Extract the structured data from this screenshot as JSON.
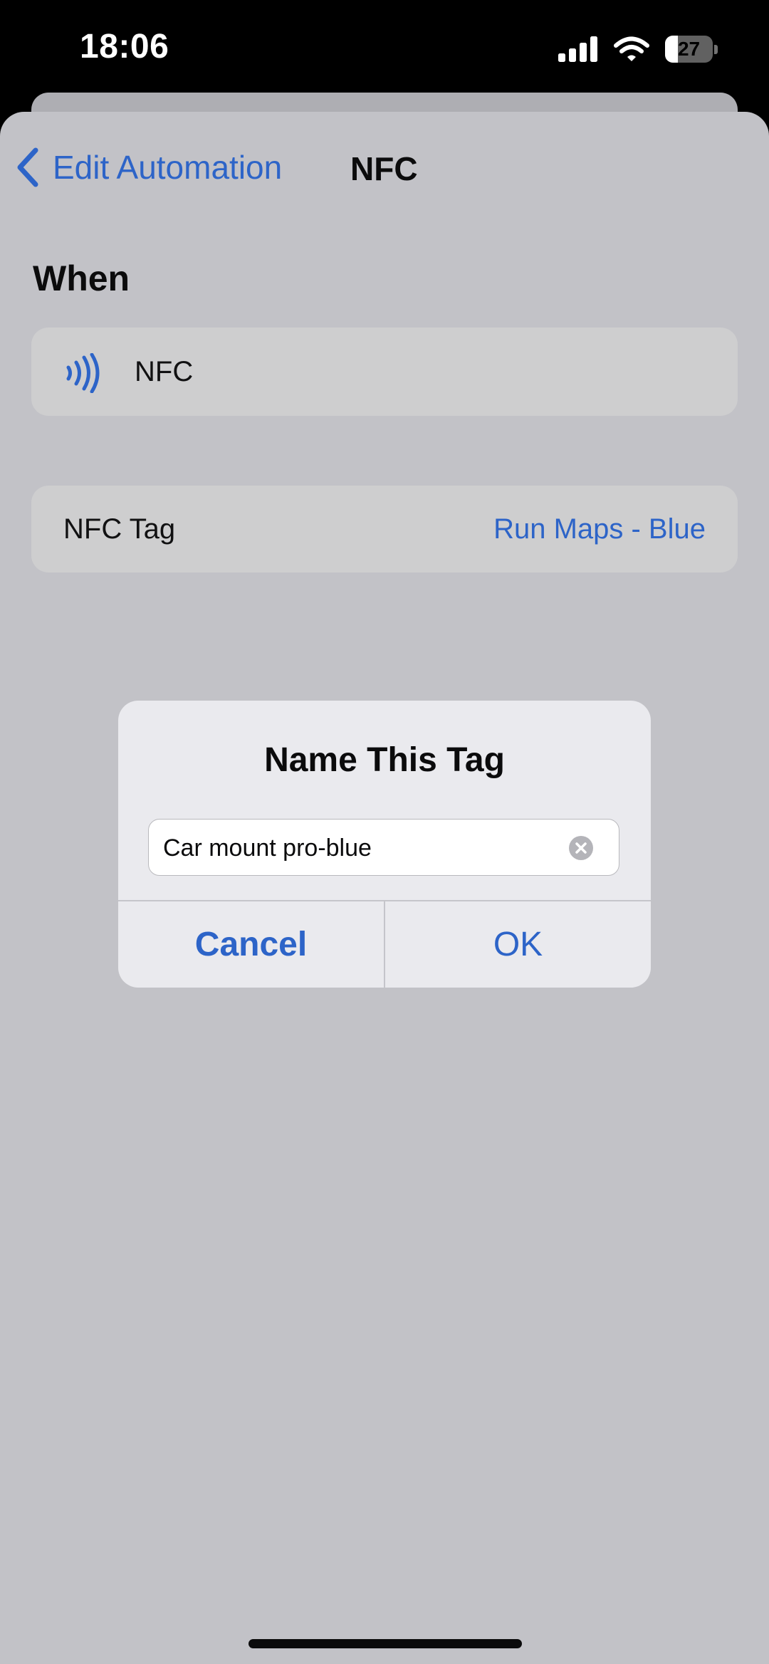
{
  "status_bar": {
    "time": "18:06",
    "battery_level": "27",
    "battery_fraction": 0.27,
    "icons": [
      "cellular-signal-icon",
      "wifi-icon",
      "battery-icon"
    ]
  },
  "nav": {
    "back_label": "Edit Automation",
    "title": "NFC"
  },
  "section": {
    "header": "When"
  },
  "trigger_row": {
    "icon": "nfc-icon",
    "label": "NFC"
  },
  "tag_row": {
    "label": "NFC Tag",
    "value": "Run Maps - Blue"
  },
  "dialog": {
    "title": "Name This Tag",
    "input_value": "Car mount pro-blue",
    "cancel_label": "Cancel",
    "ok_label": "OK"
  },
  "colors": {
    "accent": "#2d64c8",
    "sheet_background": "#c2c2c7",
    "row_background": "#cececf",
    "dialog_background": "#eaeaee",
    "status_bar_background": "#000000"
  }
}
